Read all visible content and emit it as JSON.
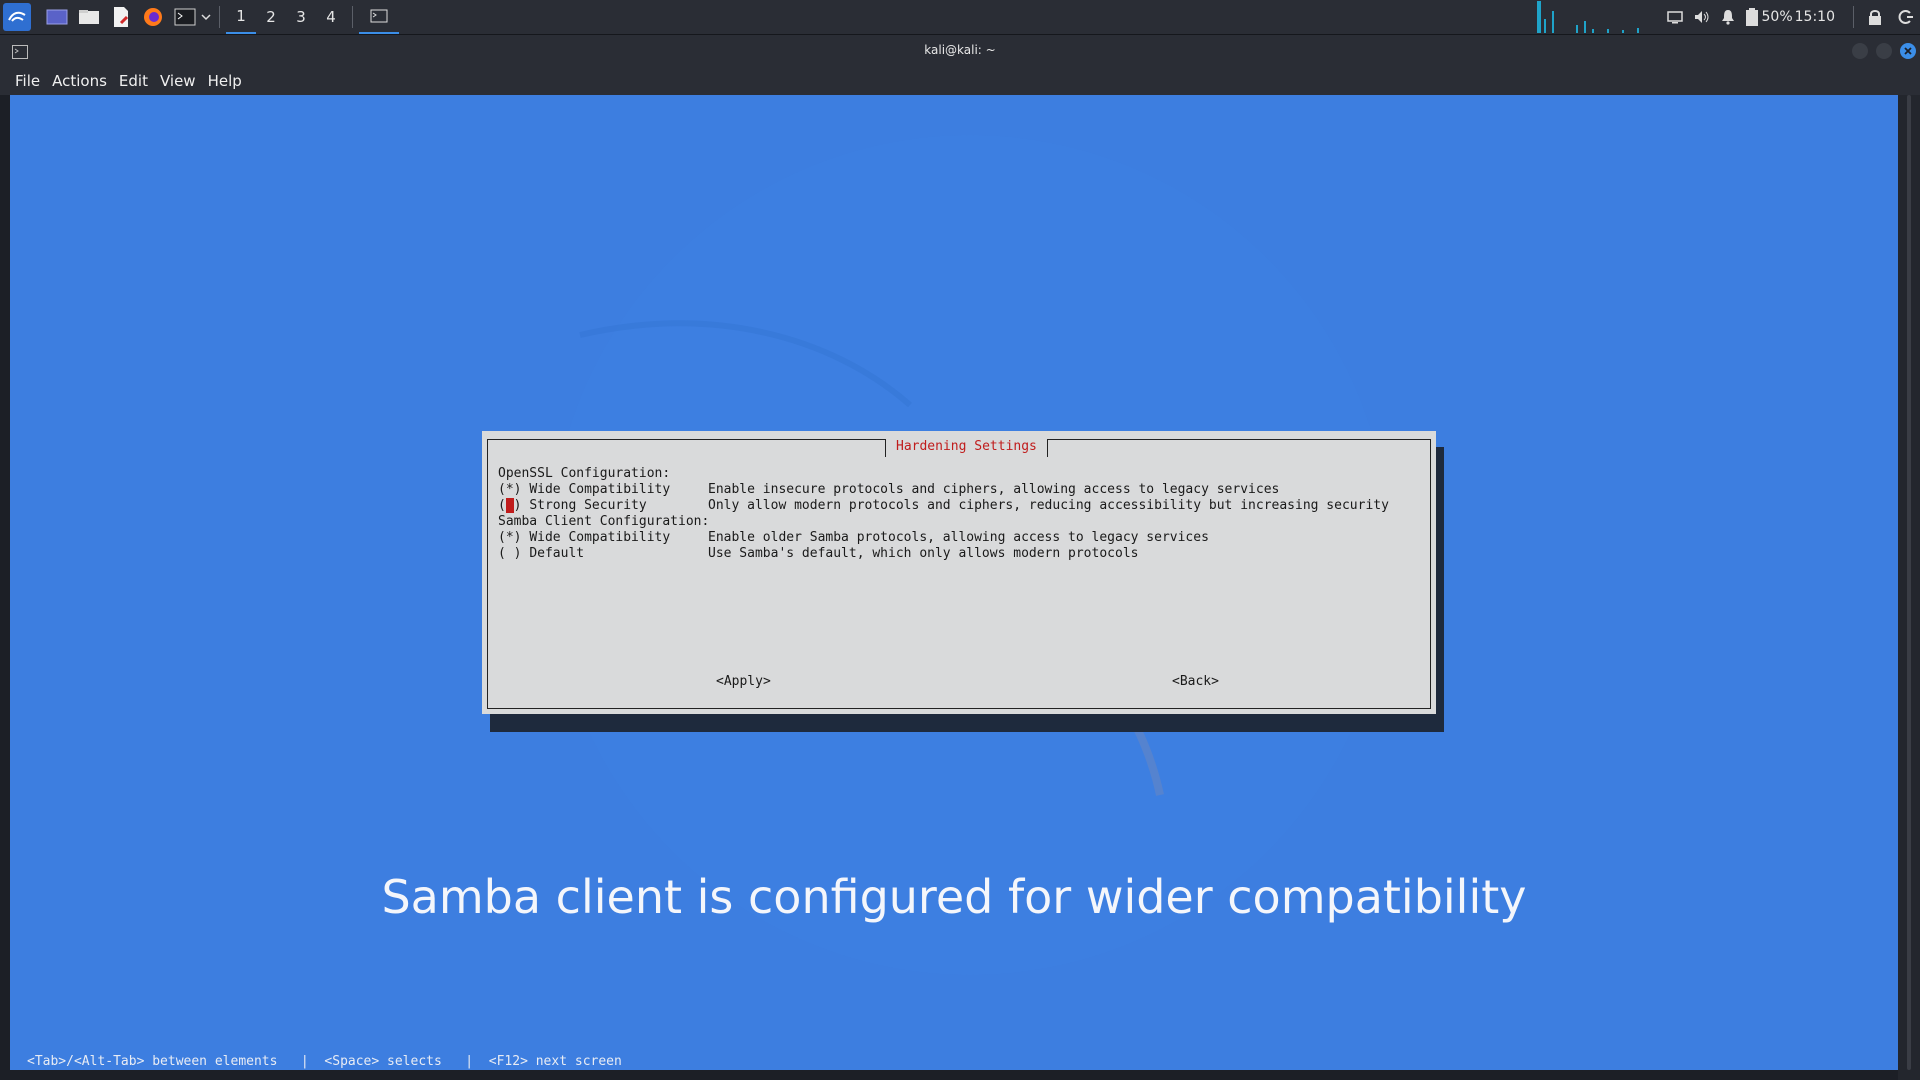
{
  "taskbar": {
    "workspaces": [
      "1",
      "2",
      "3",
      "4"
    ],
    "battery": "50%",
    "clock": "15:10"
  },
  "window": {
    "title": "kali@kali: ~",
    "menu": [
      "File",
      "Actions",
      "Edit",
      "View",
      "Help"
    ]
  },
  "dialog": {
    "title": "Hardening Settings",
    "openssl_header": "OpenSSL Configuration:",
    "openssl_options": [
      {
        "mark": "(*)",
        "label": "Wide Compatibility",
        "desc": "Enable insecure protocols and ciphers, allowing access to legacy services",
        "selected": true
      },
      {
        "mark": "( )",
        "label": "Strong Security",
        "desc": "Only allow modern protocols and ciphers, reducing accessibility but increasing security",
        "selected": false
      }
    ],
    "samba_header": "Samba Client Configuration:",
    "samba_options": [
      {
        "mark": "(*)",
        "label": "Wide Compatibility",
        "desc": "Enable older Samba protocols, allowing access to legacy services",
        "selected": true
      },
      {
        "mark": "( )",
        "label": "Default",
        "desc": "Use Samba's default, which only allows modern protocols",
        "selected": false
      }
    ],
    "apply_label": "<Apply>",
    "back_label": "<Back>"
  },
  "subtitle": "Samba client is configured for wider compatibility",
  "help_line": "<Tab>/<Alt-Tab> between elements   |  <Space> selects   |  <F12> next screen",
  "colors": {
    "terminal_bg": "#3d7ee0",
    "dialog_bg": "#d9dadb",
    "title_red": "#c01c1c"
  }
}
